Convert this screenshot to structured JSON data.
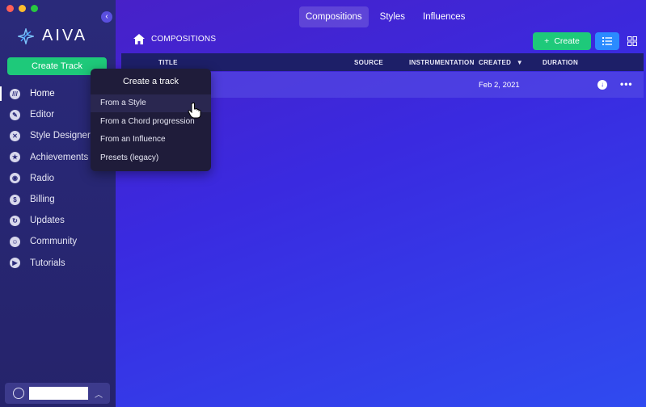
{
  "app": {
    "brand": "AIVA",
    "accent": "#1ec97a",
    "highlight": "#2b8bff"
  },
  "sidebar": {
    "create_track_label": "Create Track",
    "items": [
      {
        "label": "Home",
        "icon": "home-logo-icon",
        "active": true
      },
      {
        "label": "Editor",
        "icon": "pencil-icon"
      },
      {
        "label": "Style Designer",
        "icon": "style-icon"
      },
      {
        "label": "Achievements",
        "icon": "medal-icon"
      },
      {
        "label": "Radio",
        "icon": "radio-icon"
      },
      {
        "label": "Billing",
        "icon": "dollar-icon"
      },
      {
        "label": "Updates",
        "icon": "refresh-icon"
      },
      {
        "label": "Community",
        "icon": "discord-icon"
      },
      {
        "label": "Tutorials",
        "icon": "play-icon"
      }
    ]
  },
  "tabs": [
    {
      "label": "Compositions",
      "active": true
    },
    {
      "label": "Styles"
    },
    {
      "label": "Influences"
    }
  ],
  "breadcrumb": {
    "label": "COMPOSITIONS"
  },
  "toolbar": {
    "create_label": "Create"
  },
  "table": {
    "columns": [
      "TITLE",
      "SOURCE",
      "INSTRUMENTATION",
      "CREATED",
      "DURATION"
    ],
    "sort_column": "CREATED",
    "rows": [
      {
        "title": "",
        "source": "",
        "instrumentation": "",
        "created": "Feb 2, 2021",
        "duration": ""
      }
    ]
  },
  "dropdown": {
    "title": "Create a track",
    "items": [
      "From a Style",
      "From a Chord progression",
      "From an Influence",
      "Presets (legacy)"
    ]
  }
}
